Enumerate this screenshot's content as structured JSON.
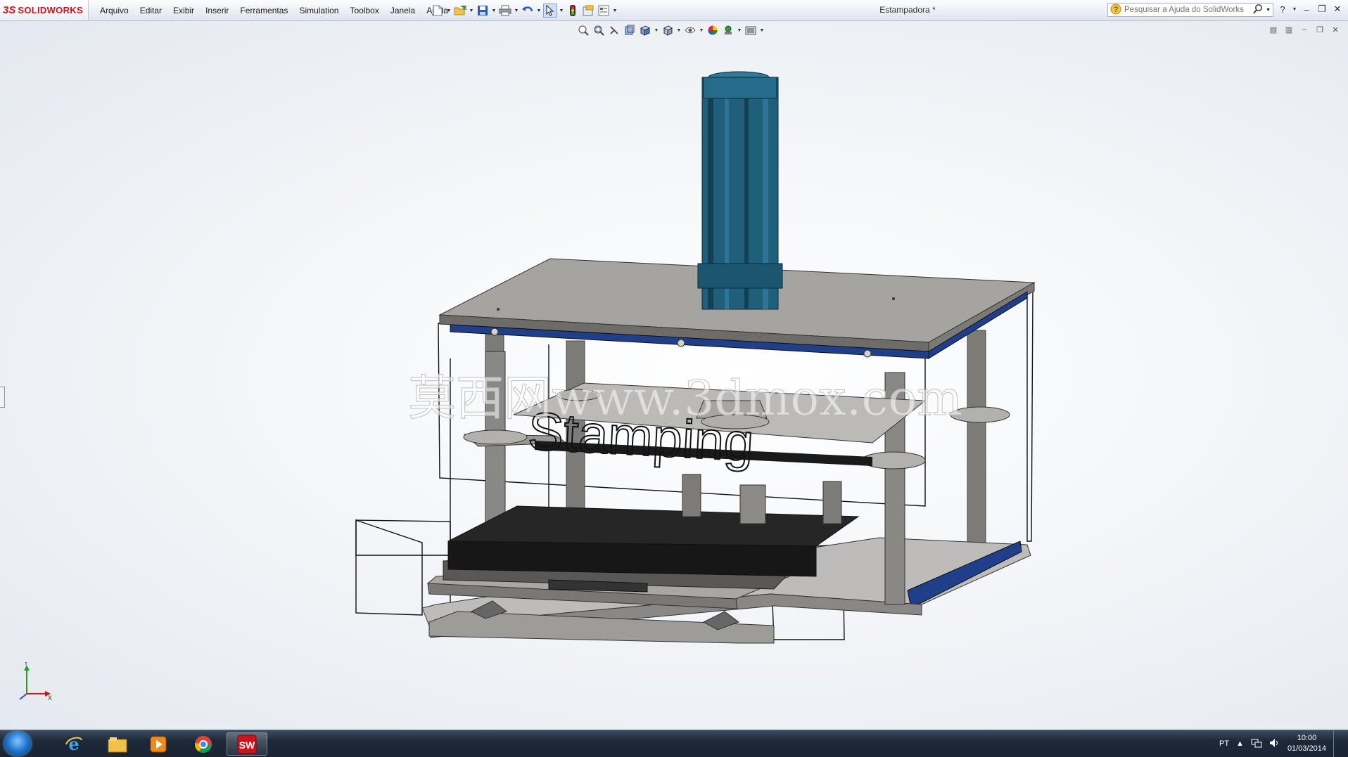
{
  "app": {
    "brand": "SOLIDWORKS",
    "brand_prefix": "3S",
    "document_title": "Estampadora *"
  },
  "menu": {
    "items": [
      "Arquivo",
      "Editar",
      "Exibir",
      "Inserir",
      "Ferramentas",
      "Simulation",
      "Toolbox",
      "Janela",
      "Ajuda"
    ]
  },
  "search": {
    "placeholder": "Pesquisar a Ajuda do SolidWorks"
  },
  "viewport": {
    "watermark": "莫西网www.3dmox.com",
    "sketch_text": "Stamping",
    "triad_x": "X",
    "triad_y": "Y"
  },
  "taskbar": {
    "language": "PT",
    "time": "10:00",
    "date": "01/03/2014"
  },
  "colors": {
    "accent": "#d0121b",
    "cylinder": "#1f5f7a",
    "plate": "#9c9a96",
    "rail": "#1f3f8a",
    "die": "#1c1c1c"
  }
}
